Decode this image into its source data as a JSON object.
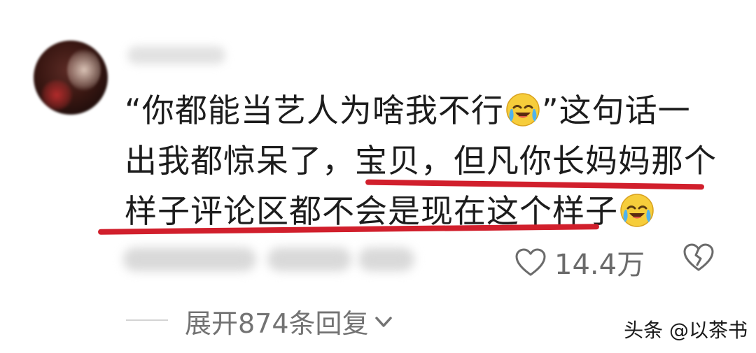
{
  "comment": {
    "part1": "“你都能当艺人为啥我不行",
    "part2": "”这句话一出我都惊呆了，宝贝，但凡你长妈妈那个样子评论区都不会是现在这个样子",
    "emoji": "crying-laughing-face"
  },
  "actions": {
    "like_count": "14.4万"
  },
  "replies": {
    "expand_label": "展开874条回复"
  },
  "watermark": "头条 @以茶书",
  "colors": {
    "underline": "#d11f2c",
    "secondary_text": "#6b6b6b"
  }
}
